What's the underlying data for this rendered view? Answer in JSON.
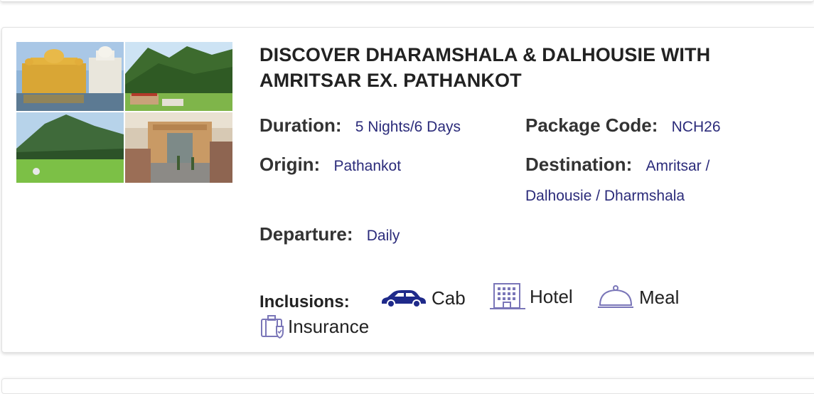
{
  "package": {
    "title": "DISCOVER DHARAMSHALA & DALHOUSIE WITH AMRITSAR EX. PATHANKOT",
    "duration_label": "Duration:",
    "duration_value": "5 Nights/6 Days",
    "package_code_label": "Package Code:",
    "package_code_value": "NCH26",
    "origin_label": "Origin:",
    "origin_value": "Pathankot",
    "destination_label": "Destination:",
    "destination_value_line1": "Amritsar /",
    "destination_value_line2": "Dalhousie / Dharmshala",
    "departure_label": "Departure:",
    "departure_value": "Daily",
    "inclusions_label": "Inclusions:",
    "inclusions": [
      {
        "label": "Cab",
        "icon": "car-icon"
      },
      {
        "label": "Hotel",
        "icon": "hotel-icon"
      },
      {
        "label": "Meal",
        "icon": "meal-cloche-icon"
      },
      {
        "label": "Insurance",
        "icon": "insurance-icon"
      }
    ]
  },
  "colors": {
    "value_text": "#2b2b7a",
    "icon_car": "#1f2a8a",
    "icon_outline": "#7a76b8",
    "title": "#222222"
  }
}
